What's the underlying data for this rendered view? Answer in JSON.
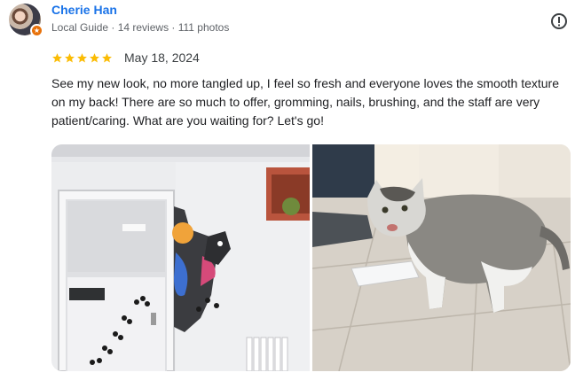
{
  "reviewer": {
    "name": "Cherie Han",
    "meta": "Local Guide · 14 reviews · 111 photos",
    "avatar_icon": "user-avatar",
    "badge_icon": "local-guide-star-icon"
  },
  "actions": {
    "report_icon": "report-exclamation-icon"
  },
  "review": {
    "rating": 5,
    "rating_max": 5,
    "date": "May 18, 2024",
    "text": "See my new look, no more tangled up, I feel so fresh and everyone loves the smooth texture on my back! There are so much to offer, gromming, nails, brushing, and the staff are very patient/caring. What are you waiting for? Let's go!"
  },
  "photos": [
    {
      "name": "grooming-room-photo"
    },
    {
      "name": "groomed-cat-photo"
    }
  ],
  "colors": {
    "name_link": "#1a73e8",
    "star": "#fbbc04",
    "badge": "#e8710a",
    "meta_text": "#5f6368"
  }
}
